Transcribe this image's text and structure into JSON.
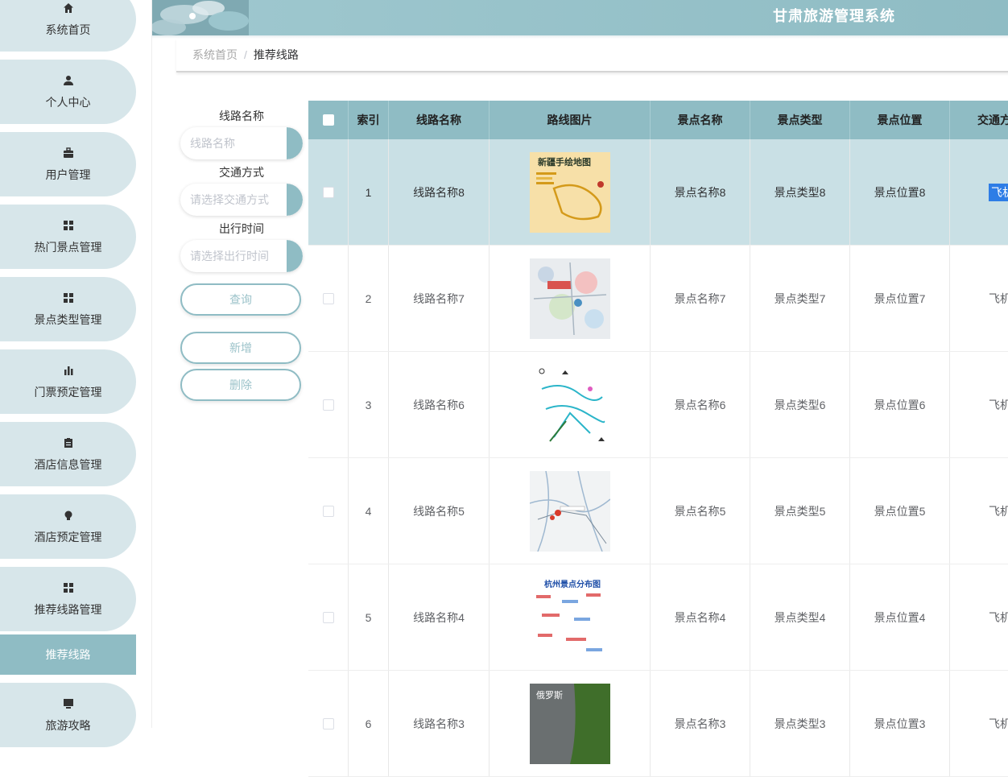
{
  "app": {
    "title": "甘肃旅游管理系统"
  },
  "sidebar": {
    "items": [
      {
        "label": "系统首页",
        "icon": "home-icon"
      },
      {
        "label": "个人中心",
        "icon": "user-icon"
      },
      {
        "label": "用户管理",
        "icon": "briefcase-icon"
      },
      {
        "label": "热门景点管理",
        "icon": "grid-icon"
      },
      {
        "label": "景点类型管理",
        "icon": "grid-icon"
      },
      {
        "label": "门票预定管理",
        "icon": "bar-chart-icon"
      },
      {
        "label": "酒店信息管理",
        "icon": "clipboard-icon"
      },
      {
        "label": "酒店预定管理",
        "icon": "bulb-icon"
      },
      {
        "label": "推荐线路管理",
        "icon": "grid-icon"
      }
    ],
    "active_sub": "推荐线路",
    "last_item": {
      "label": "旅游攻略",
      "icon": "monitor-icon"
    }
  },
  "breadcrumb": {
    "home": "系统首页",
    "separator": "/",
    "current": "推荐线路"
  },
  "filter": {
    "route_name_label": "线路名称",
    "route_name_placeholder": "线路名称",
    "transport_label": "交通方式",
    "transport_placeholder": "请选择交通方式",
    "time_label": "出行时间",
    "time_placeholder": "请选择出行时间",
    "query_button": "查询",
    "add_button": "新增",
    "delete_button": "删除"
  },
  "table": {
    "headers": [
      "索引",
      "线路名称",
      "路线图片",
      "景点名称",
      "景点类型",
      "景点位置",
      "交通方"
    ],
    "rows": [
      {
        "index": "1",
        "name": "线路名称8",
        "spot": "景点名称8",
        "type": "景点类型8",
        "loc": "景点位置8",
        "transport": "飞机",
        "selected": true
      },
      {
        "index": "2",
        "name": "线路名称7",
        "spot": "景点名称7",
        "type": "景点类型7",
        "loc": "景点位置7",
        "transport": "飞机",
        "selected": false
      },
      {
        "index": "3",
        "name": "线路名称6",
        "spot": "景点名称6",
        "type": "景点类型6",
        "loc": "景点位置6",
        "transport": "飞机",
        "selected": false
      },
      {
        "index": "4",
        "name": "线路名称5",
        "spot": "景点名称5",
        "type": "景点类型5",
        "loc": "景点位置5",
        "transport": "飞机",
        "selected": false
      },
      {
        "index": "5",
        "name": "线路名称4",
        "spot": "景点名称4",
        "type": "景点类型4",
        "loc": "景点位置4",
        "transport": "飞机",
        "selected": false
      },
      {
        "index": "6",
        "name": "线路名称3",
        "spot": "景点名称3",
        "type": "景点类型3",
        "loc": "景点位置3",
        "transport": "飞机",
        "selected": false
      }
    ],
    "image_titles": [
      "新疆手绘地图",
      "",
      "",
      "",
      "杭州景点分布图",
      "俄罗斯"
    ]
  },
  "colors": {
    "accent": "#8fbcc4",
    "sidebar_bg": "#d7e6ea",
    "selection": "#2e7de6"
  }
}
